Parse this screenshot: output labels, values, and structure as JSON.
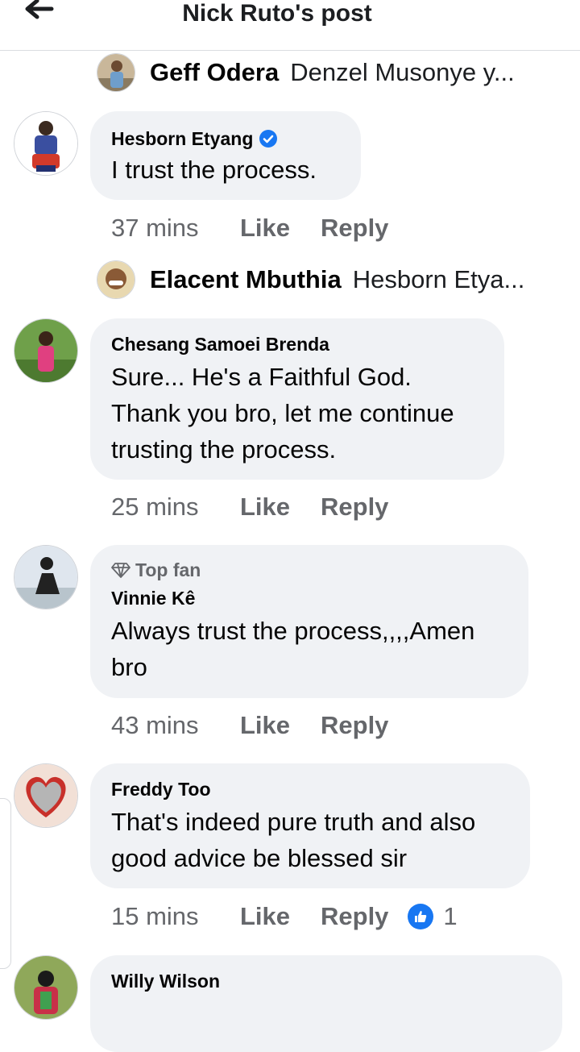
{
  "header": {
    "title": "Nick Ruto's post",
    "back_icon": "arrow-left-icon"
  },
  "thread": [
    {
      "type": "reply_preview",
      "name": "Geff Odera",
      "text": "Denzel Musonye y..."
    },
    {
      "type": "comment",
      "name": "Hesborn Etyang",
      "verified": true,
      "text": [
        "I trust the process."
      ],
      "time": "37 mins"
    },
    {
      "type": "reply_preview",
      "name": "Elacent Mbuthia",
      "text": "Hesborn Etya..."
    },
    {
      "type": "comment",
      "name": "Chesang Samoei Brenda",
      "text": [
        "Sure... He's a Faithful God.",
        "Thank you bro, let me continue",
        "trusting the process."
      ],
      "time": "25 mins"
    },
    {
      "type": "comment",
      "badge": "Top fan",
      "name": "Vinnie Kê",
      "text": [
        "Always trust the process,,,,Amen",
        "bro"
      ],
      "time": "43 mins"
    },
    {
      "type": "comment",
      "name": "Freddy Too",
      "text": [
        "That's indeed pure truth and also",
        "good advice be blessed sir"
      ],
      "time": "15 mins",
      "reactions": {
        "icon": "thumbs-up-icon",
        "count": "1",
        "color": "#1877f2"
      }
    },
    {
      "type": "comment",
      "name": "Willy Wilson",
      "text": [
        ""
      ]
    }
  ],
  "actions": {
    "like": "Like",
    "reply": "Reply"
  },
  "colors": {
    "bubble": "#f0f2f5",
    "meta_text": "#65676b",
    "verified": "#1877f2"
  }
}
